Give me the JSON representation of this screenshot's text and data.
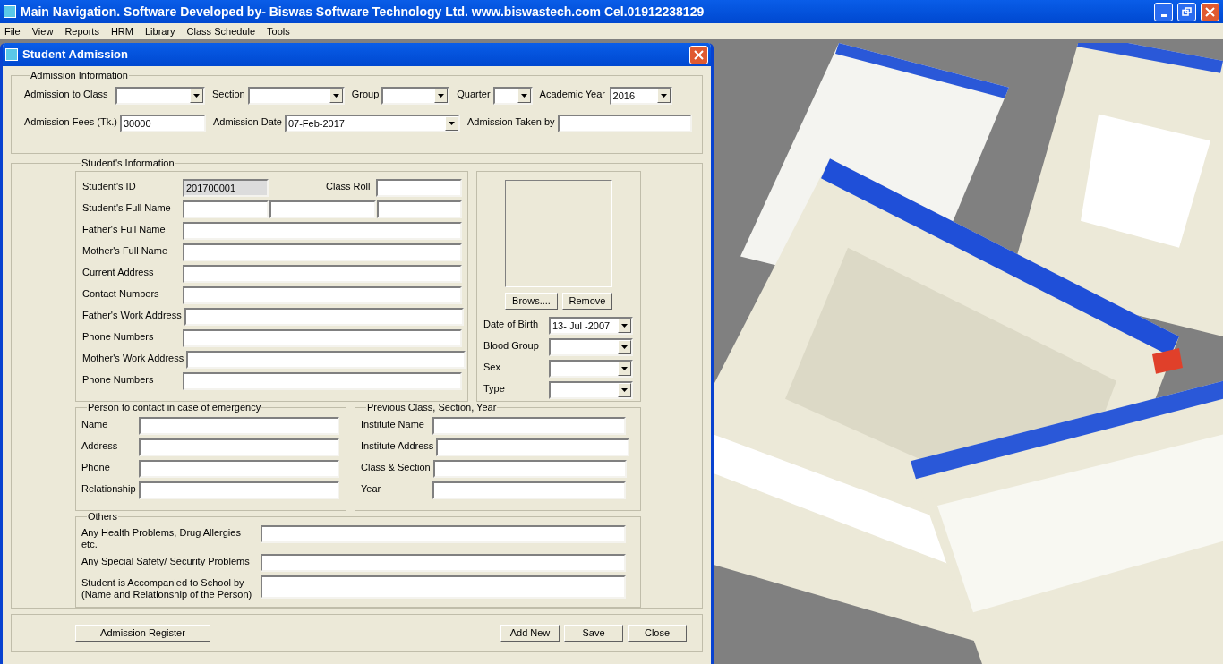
{
  "window": {
    "title": "Main Navigation. Software Developed by- Biswas Software Technology Ltd. www.biswastech.com Cel.01912238129"
  },
  "menu": [
    "File",
    "View",
    "Reports",
    "HRM",
    "Library",
    "Class Schedule",
    "Tools"
  ],
  "form": {
    "title": "Student Admission",
    "admission": {
      "legend": "Admission Information",
      "fields": [
        {
          "label": "Admission to Class",
          "kind": "combo"
        },
        {
          "label": "Section",
          "kind": "combo"
        },
        {
          "label": "Group",
          "kind": "combo"
        },
        {
          "label": "Quarter",
          "kind": "combo"
        },
        {
          "label": "Academic Year",
          "kind": "combo",
          "value": "2016"
        },
        {
          "label": "Admission Fees (Tk.)",
          "kind": "text",
          "value": "30000"
        },
        {
          "label": "Admission Date",
          "kind": "combo",
          "value": "07-Feb-2017"
        },
        {
          "label": "Admission Taken by",
          "kind": "text"
        }
      ]
    },
    "student": {
      "legend": "Student's Information",
      "id": {
        "label": "Student's ID",
        "value": "201700001",
        "disabled": true
      },
      "roll": {
        "label": "Class Roll",
        "disabled": false
      },
      "full_name": {
        "label": "Student's Full Name"
      },
      "fields": [
        "Father's Full Name",
        "Mother's Full Name",
        "Current Address",
        "Contact Numbers",
        "Father's Work Address",
        "Phone Numbers",
        "Mother's Work Address",
        "Phone Numbers"
      ],
      "photo_buttons": [
        "Brows....",
        "Remove"
      ],
      "combos": [
        {
          "label": "Date of Birth",
          "value": "13- Jul -2007"
        },
        {
          "label": "Blood Group"
        },
        {
          "label": "Sex"
        },
        {
          "label": "Type"
        }
      ]
    },
    "emergency": {
      "legend": "Person to contact in case of emergency",
      "fields": [
        "Name",
        "Address",
        "Phone",
        "Relationship"
      ]
    },
    "previous": {
      "legend": "Previous Class, Section, Year",
      "fields": [
        "Institute Name",
        "Institute Address",
        "Class & Section",
        "Year"
      ]
    },
    "others": {
      "legend": "Others",
      "fields": [
        "Any Health Problems, Drug Allergies etc.",
        "Any Special Safety/ Security Problems",
        "Student is Accompanied to School by (Name and Relationship of the Person)"
      ]
    },
    "buttons_left": [
      "Admission Register"
    ],
    "buttons_right": [
      "Add New",
      "Save",
      "Close"
    ]
  },
  "background": {
    "kind": "picture"
  }
}
